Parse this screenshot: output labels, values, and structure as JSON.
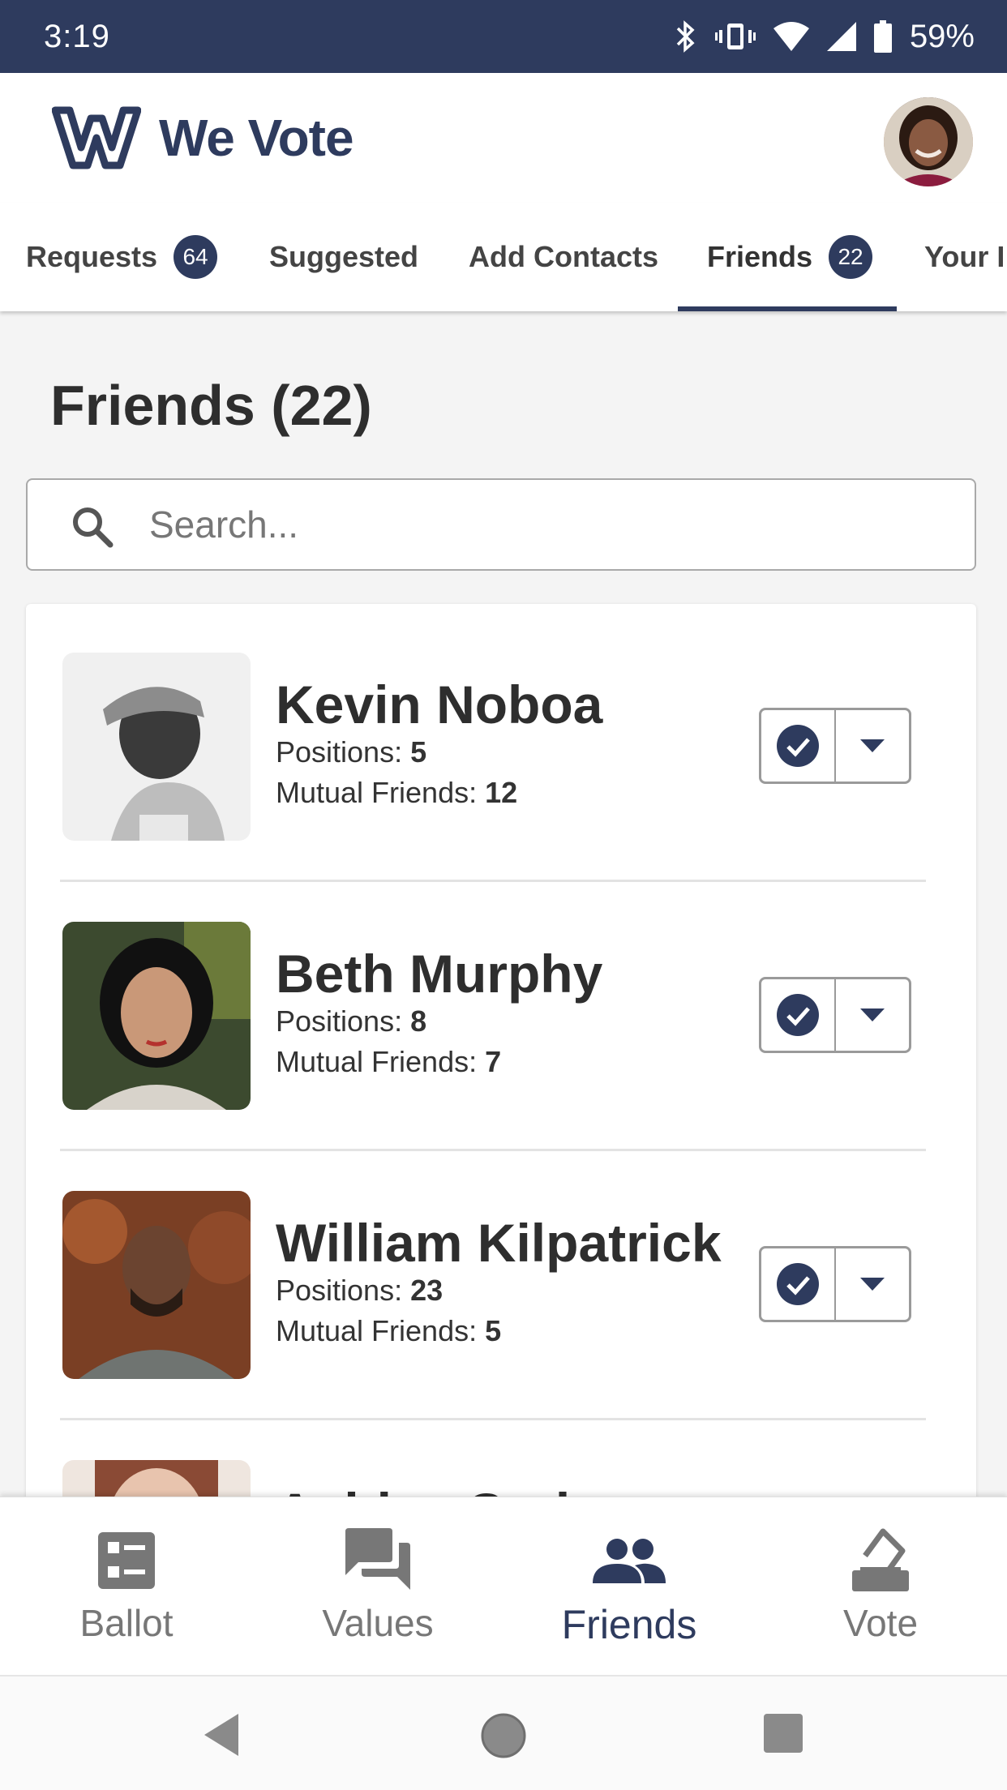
{
  "status_bar": {
    "time": "3:19",
    "battery": "59%",
    "icons": [
      "bluetooth-icon",
      "vibrate-icon",
      "wifi-icon",
      "signal-icon",
      "battery-icon"
    ]
  },
  "header": {
    "logo_text": "We Vote",
    "brand_color": "#2e3b5e"
  },
  "tabs": [
    {
      "label": "Requests",
      "badge": "64"
    },
    {
      "label": "Suggested"
    },
    {
      "label": "Add Contacts"
    },
    {
      "label": "Friends",
      "badge": "22",
      "active": true
    },
    {
      "label": "Your I"
    }
  ],
  "page": {
    "title": "Friends (22)",
    "search_placeholder": "Search..."
  },
  "labels": {
    "positions": "Positions:",
    "mutual_friends": "Mutual Friends:"
  },
  "friends": [
    {
      "name": "Kevin Noboa",
      "positions": "5",
      "mutual_friends": "12"
    },
    {
      "name": "Beth Murphy",
      "positions": "8",
      "mutual_friends": "7"
    },
    {
      "name": "William Kilpatrick",
      "positions": "23",
      "mutual_friends": "5"
    },
    {
      "name": "Ashley Carlson"
    }
  ],
  "bottom_nav": [
    {
      "label": "Ballot",
      "icon": "ballot-icon"
    },
    {
      "label": "Values",
      "icon": "values-icon"
    },
    {
      "label": "Friends",
      "icon": "friends-icon",
      "active": true
    },
    {
      "label": "Vote",
      "icon": "vote-icon"
    }
  ]
}
